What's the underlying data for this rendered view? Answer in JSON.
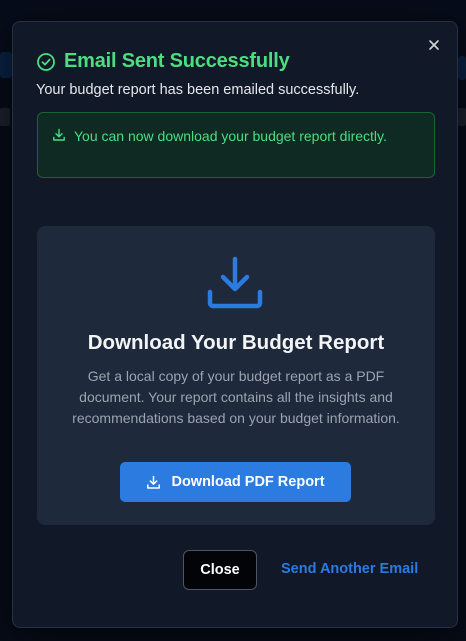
{
  "modal": {
    "title": "Email Sent Successfully",
    "subtitle": "Your budget report has been emailed successfully.",
    "notice": "You can now download your budget report directly.",
    "card": {
      "title": "Download Your Budget Report",
      "description": "Get a local copy of your budget report as a PDF document. Your report contains all the insights and recommendations based on your budget information.",
      "button_label": "Download PDF Report"
    },
    "footer": {
      "close_label": "Close",
      "send_another_label": "Send Another Email"
    }
  },
  "icons": {
    "title": "check-circle-icon",
    "close": "close-icon",
    "notice": "download-icon",
    "card": "download-icon",
    "button": "download-icon"
  },
  "colors": {
    "success": "#4ade80",
    "primary": "#2b7be0",
    "modal_bg": "#111827",
    "card_bg": "#1e293b"
  }
}
